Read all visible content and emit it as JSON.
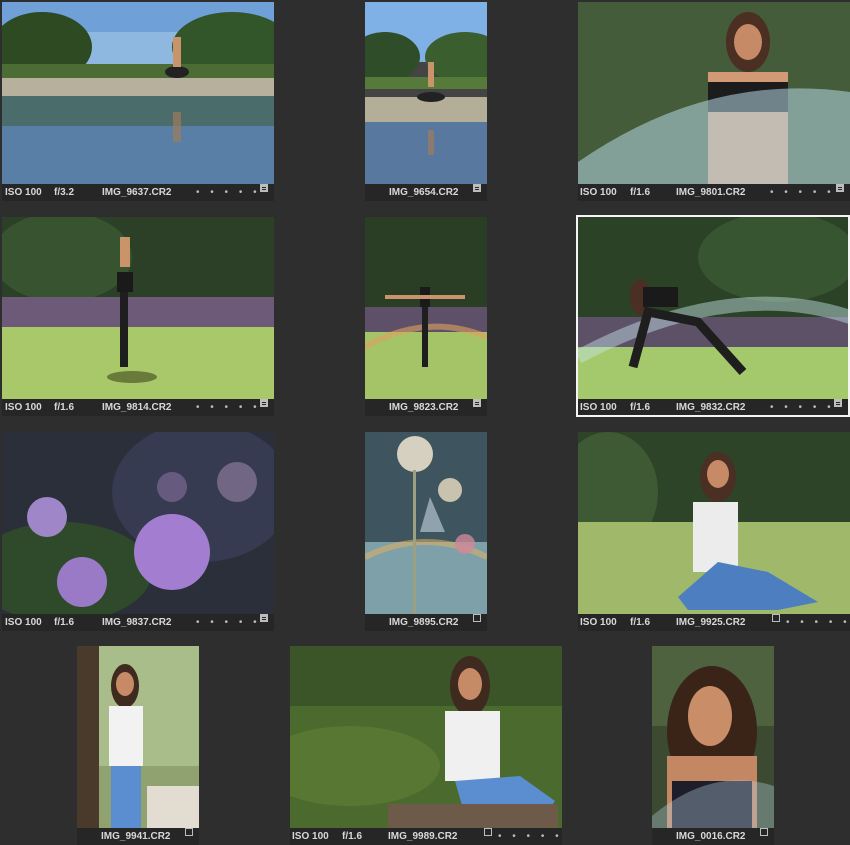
{
  "photos": [
    {
      "iso": "ISO 100",
      "aperture": "f/3.2",
      "filename": "IMG_9637.CR2",
      "dots": "• • • • •",
      "badge": "filled"
    },
    {
      "iso": "",
      "aperture": "",
      "filename": "IMG_9654.CR2",
      "dots": "",
      "badge": "filled"
    },
    {
      "iso": "ISO 100",
      "aperture": "f/1.6",
      "filename": "IMG_9801.CR2",
      "dots": "• • • • •",
      "badge": "filled"
    },
    {
      "iso": "ISO 100",
      "aperture": "f/1.6",
      "filename": "IMG_9814.CR2",
      "dots": "• • • • •",
      "badge": "filled"
    },
    {
      "iso": "",
      "aperture": "",
      "filename": "IMG_9823.CR2",
      "dots": "",
      "badge": "filled"
    },
    {
      "iso": "ISO 100",
      "aperture": "f/1.6",
      "filename": "IMG_9832.CR2",
      "dots": "• • • • •",
      "badge": "filled",
      "selected": true
    },
    {
      "iso": "ISO 100",
      "aperture": "f/1.6",
      "filename": "IMG_9837.CR2",
      "dots": "• • • • •",
      "badge": "filled"
    },
    {
      "iso": "",
      "aperture": "",
      "filename": "IMG_9895.CR2",
      "dots": "",
      "badge": "empty"
    },
    {
      "iso": "ISO 100",
      "aperture": "f/1.6",
      "filename": "IMG_9925.CR2",
      "dots": "• • • • •",
      "badge": "empty"
    },
    {
      "iso": "",
      "aperture": "",
      "filename": "IMG_9941.CR2",
      "dots": "",
      "badge": "empty"
    },
    {
      "iso": "ISO 100",
      "aperture": "f/1.6",
      "filename": "IMG_9989.CR2",
      "dots": "• • • • •",
      "badge": "empty"
    },
    {
      "iso": "",
      "aperture": "",
      "filename": "IMG_0016.CR2",
      "dots": "",
      "badge": "empty"
    }
  ]
}
